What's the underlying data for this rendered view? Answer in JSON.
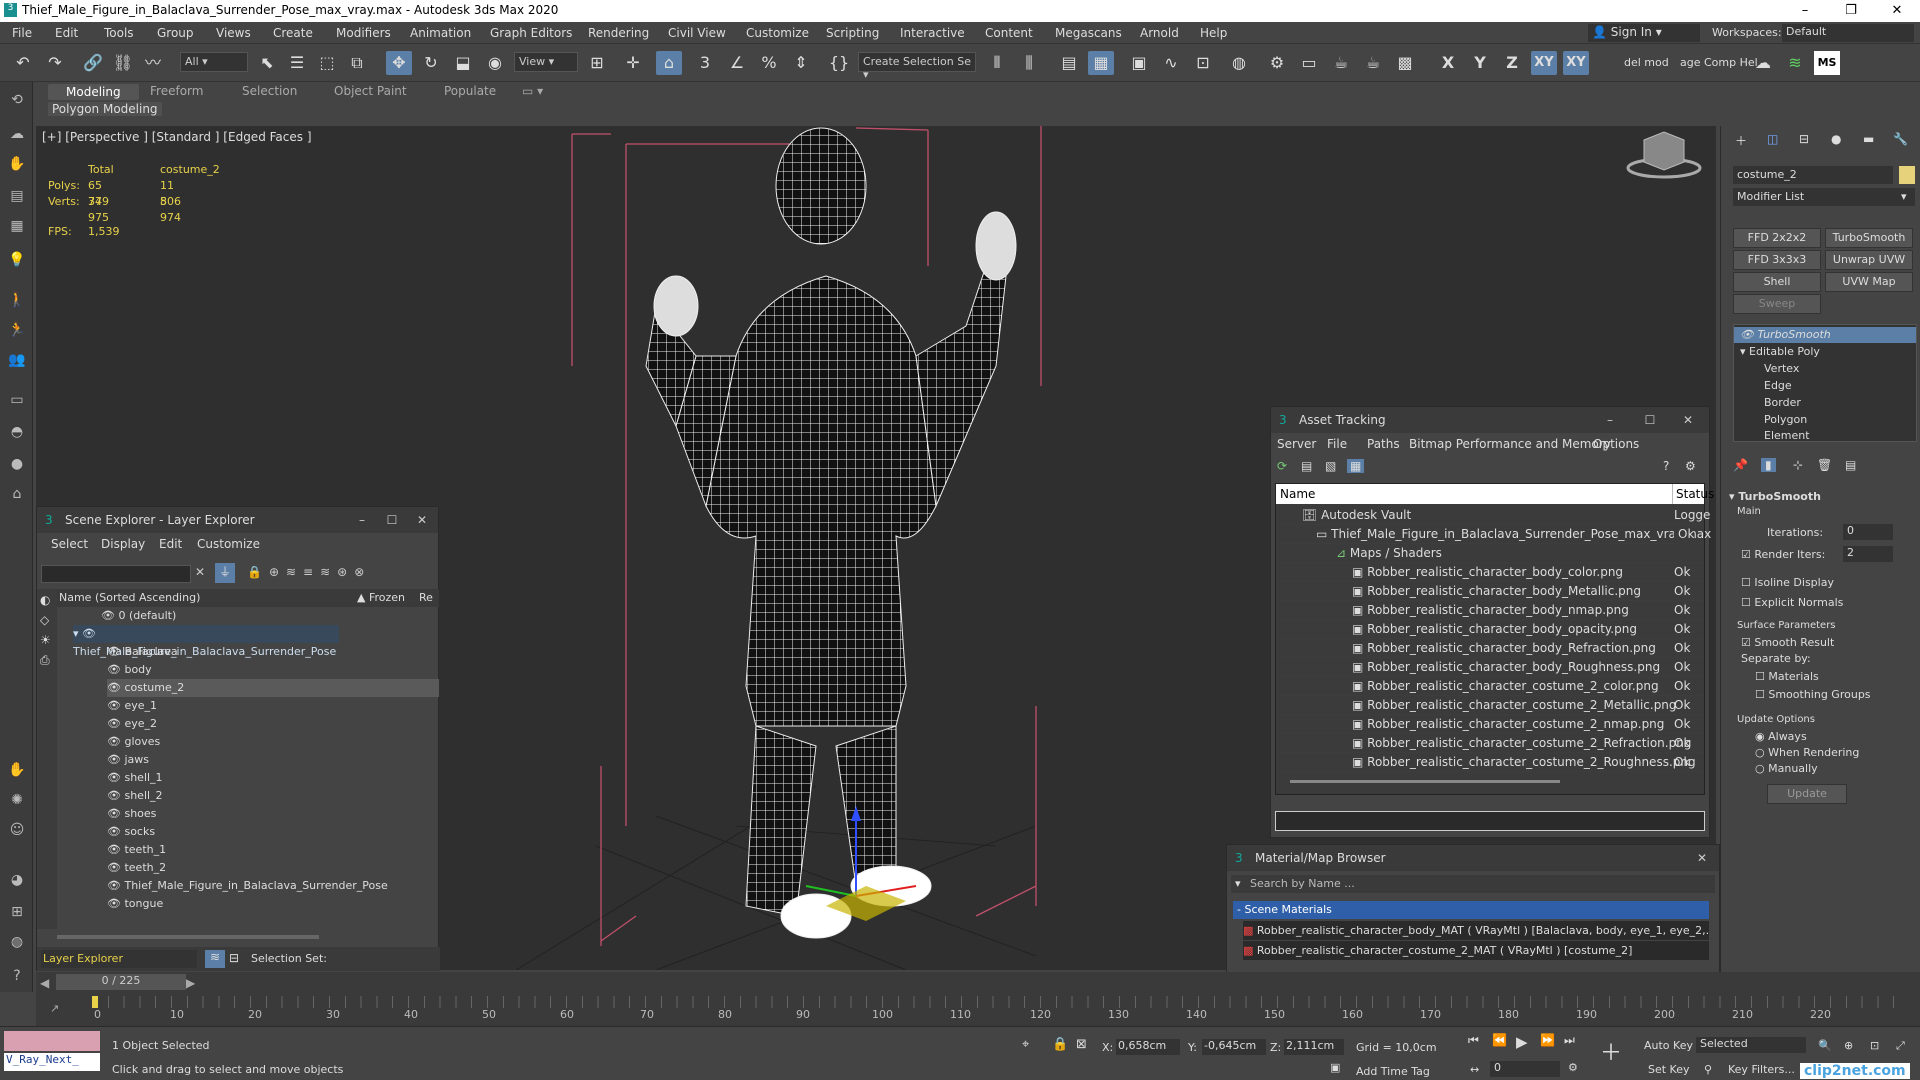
{
  "window": {
    "title": "Thief_Male_Figure_in_Balaclava_Surrender_Pose_max_vray.max - Autodesk 3ds Max 2020",
    "minimize": "–",
    "maximize": "❐",
    "close": "✕"
  },
  "menu": [
    "File",
    "Edit",
    "Tools",
    "Group",
    "Views",
    "Create",
    "Modifiers",
    "Animation",
    "Graph Editors",
    "Rendering",
    "Civil View",
    "Customize",
    "Scripting",
    "Interactive",
    "Content",
    "Megascans",
    "Arnold",
    "Help"
  ],
  "account": {
    "signin": "Sign In",
    "workspaces_label": "Workspaces:",
    "workspace": "Default"
  },
  "toolbar": {
    "filter": "All",
    "view": "View",
    "selset": "Create Selection Se",
    "axes": [
      "X",
      "Y",
      "Z",
      "XY",
      "XY"
    ],
    "extra1": "del mod",
    "extra2": "age Comp Hel",
    "ms": "MS"
  },
  "ribbon": {
    "tabs": [
      "Modeling",
      "Freeform",
      "Selection",
      "Object Paint",
      "Populate"
    ],
    "sub": "Polygon Modeling"
  },
  "viewport": {
    "label": "[+] [Perspective ] [Standard ] [Edged Faces ]",
    "stats": {
      "total": "Total",
      "obj": "costume_2",
      "polys_label": "Polys:",
      "polys_total": "65 779",
      "polys_obj": "11 806",
      "verts_label": "Verts:",
      "verts_total": "34 975",
      "verts_obj": "5 974",
      "fps_label": "FPS:",
      "fps": "1,539"
    }
  },
  "scene_explorer": {
    "title": "Scene Explorer - Layer Explorer",
    "menu": [
      "Select",
      "Display",
      "Edit",
      "Customize"
    ],
    "col_name": "Name (Sorted Ascending)",
    "col_frozen": "▲ Frozen",
    "col_re": "Re",
    "items": [
      "0 (default)",
      "Thief_Male_Figure_in_Balaclava_Surrender_Pose",
      "Balaclava",
      "body",
      "costume_2",
      "eye_1",
      "eye_2",
      "gloves",
      "jaws",
      "shell_1",
      "shell_2",
      "shoes",
      "socks",
      "teeth_1",
      "teeth_2",
      "Thief_Male_Figure_in_Balaclava_Surrender_Pose",
      "tongue"
    ],
    "footer_layer": "Layer Explorer",
    "footer_selset": "Selection Set:"
  },
  "asset_tracking": {
    "title": "Asset Tracking",
    "menu": [
      "Server",
      "File",
      "Paths",
      "Bitmap Performance and Memory",
      "Options"
    ],
    "col_name": "Name",
    "col_status": "Status",
    "rows": [
      {
        "name": "Autodesk Vault",
        "status": "Logge"
      },
      {
        "name": "Thief_Male_Figure_in_Balaclava_Surrender_Pose_max_vray.max",
        "status": "Ok"
      },
      {
        "name": "Maps / Shaders",
        "status": ""
      },
      {
        "name": "Robber_realistic_character_body_color.png",
        "status": "Ok"
      },
      {
        "name": "Robber_realistic_character_body_Metallic.png",
        "status": "Ok"
      },
      {
        "name": "Robber_realistic_character_body_nmap.png",
        "status": "Ok"
      },
      {
        "name": "Robber_realistic_character_body_opacity.png",
        "status": "Ok"
      },
      {
        "name": "Robber_realistic_character_body_Refraction.png",
        "status": "Ok"
      },
      {
        "name": "Robber_realistic_character_body_Roughness.png",
        "status": "Ok"
      },
      {
        "name": "Robber_realistic_character_costume_2_color.png",
        "status": "Ok"
      },
      {
        "name": "Robber_realistic_character_costume_2_Metallic.png",
        "status": "Ok"
      },
      {
        "name": "Robber_realistic_character_costume_2_nmap.png",
        "status": "Ok"
      },
      {
        "name": "Robber_realistic_character_costume_2_Refraction.png",
        "status": "Ok"
      },
      {
        "name": "Robber_realistic_character_costume_2_Roughness.png",
        "status": "Ok"
      }
    ]
  },
  "material_browser": {
    "title": "Material/Map Browser",
    "search": "Search by Name ...",
    "group": "- Scene Materials",
    "items": [
      "Robber_realistic_character_body_MAT ( VRayMtl ) [Balaclava, body, eye_1, eye_2,...",
      "Robber_realistic_character_costume_2_MAT ( VRayMtl ) [costume_2]"
    ]
  },
  "command_panel": {
    "object_name": "costume_2",
    "modifier_list": "Modifier List",
    "buttons": [
      "FFD 2x2x2",
      "TurboSmooth",
      "FFD 3x3x3",
      "Unwrap UVW",
      "Shell",
      "UVW Map",
      "Sweep"
    ],
    "stack": [
      "TurboSmooth",
      "Editable Poly",
      "Vertex",
      "Edge",
      "Border",
      "Polygon",
      "Element"
    ],
    "rollout": "TurboSmooth",
    "main": "Main",
    "iterations_label": "Iterations:",
    "iterations": "0",
    "render_iters_label": "Render Iters:",
    "render_iters": "2",
    "isoline": "Isoline Display",
    "explicit": "Explicit Normals",
    "surface": "Surface Parameters",
    "smooth": "Smooth Result",
    "separate": "Separate by:",
    "materials": "Materials",
    "smoothing": "Smoothing Groups",
    "update_opts": "Update Options",
    "always": "Always",
    "when_rendering": "When Rendering",
    "manually": "Manually",
    "update": "Update"
  },
  "timeline": {
    "frame": "0 / 225",
    "ticks": [
      "0",
      "10",
      "20",
      "30",
      "40",
      "50",
      "60",
      "70",
      "80",
      "90",
      "100",
      "110",
      "120",
      "130",
      "140",
      "150",
      "160",
      "170",
      "180",
      "190",
      "200",
      "210",
      "220"
    ]
  },
  "status": {
    "script": "V_Ray_Next_",
    "selected": "1 Object Selected",
    "hint": "Click and drag to select and move objects",
    "x_label": "X:",
    "x": "0,658cm",
    "y_label": "Y:",
    "y": "-0,645cm",
    "z_label": "Z:",
    "z": "2,111cm",
    "grid": "Grid = 10,0cm",
    "add_time_tag": "Add Time Tag",
    "auto_key": "Auto Key",
    "set_key": "Set Key",
    "selected_dd": "Selected",
    "key_filters": "Key Filters...",
    "frame_field": "0",
    "watermark": "clip2net.com"
  }
}
